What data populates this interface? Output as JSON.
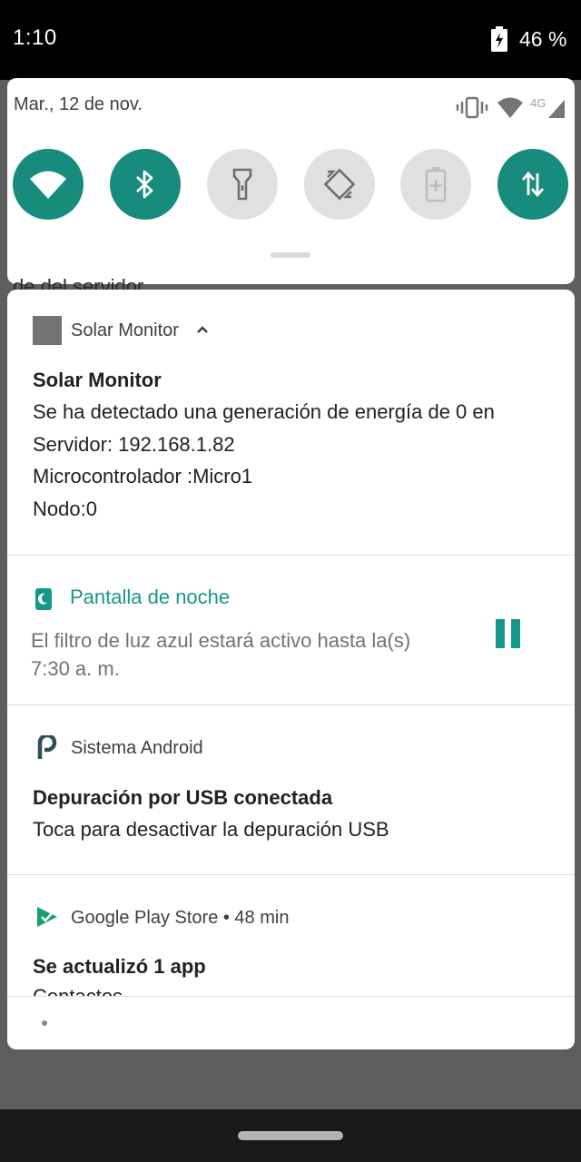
{
  "status_bar": {
    "time": "1:10",
    "battery": "46 %"
  },
  "quick_settings": {
    "date": "Mar., 12 de nov.",
    "network_label": "4G",
    "accent_color": "#178c7c",
    "tiles": [
      {
        "icon": "wifi-icon",
        "state": "on"
      },
      {
        "icon": "bluetooth-icon",
        "state": "on"
      },
      {
        "icon": "flashlight-icon",
        "state": "off"
      },
      {
        "icon": "auto-rotate-icon",
        "state": "off"
      },
      {
        "icon": "battery-saver-icon",
        "state": "off"
      },
      {
        "icon": "mobile-data-icon",
        "state": "on"
      }
    ]
  },
  "background_peek_text": "de del servidor",
  "notifications": {
    "solar": {
      "app_name": "Solar Monitor",
      "title": "Solar Monitor",
      "lines": [
        "Se ha detectado una generación de energía de 0 en",
        "Servidor: 192.168.1.82",
        "Microcontrolador :Micro1",
        "Nodo:0"
      ]
    },
    "night_light": {
      "title": "Pantalla de noche",
      "lines": [
        "El filtro de luz azul estará activo hasta la(s)",
        "7:30 a. m."
      ]
    },
    "android": {
      "app_name": "Sistema Android",
      "title": "Depuración por USB conectada",
      "text": "Toca para desactivar la depuración USB"
    },
    "play_store": {
      "header": "Google Play Store • 48 min",
      "title": "Se actualizó 1 app",
      "text": "Contactos"
    }
  }
}
